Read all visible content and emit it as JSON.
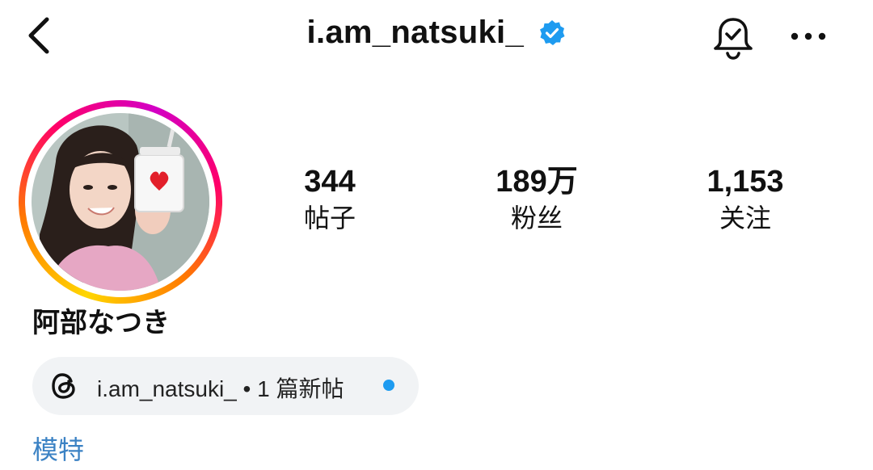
{
  "header": {
    "username": "i.am_natsuki_",
    "verified": true,
    "icons": {
      "back": "chevron-left-icon",
      "verified": "verified-badge-icon",
      "notifications": "bell-check-icon",
      "more": "more-horizontal-icon"
    }
  },
  "profile": {
    "display_name": "阿部なつき",
    "stats": [
      {
        "value": "344",
        "label": "帖子"
      },
      {
        "value": "189万",
        "label": "粉丝"
      },
      {
        "value": "1,153",
        "label": "关注"
      }
    ],
    "threads_badge": {
      "text": "i.am_natsuki_ • 1 篇新帖",
      "icon": "threads-icon",
      "has_new_dot": true
    },
    "category": "模特"
  },
  "colors": {
    "verified": "#1e9bf0",
    "category": "#3b82c4",
    "new_dot": "#1e9bf0",
    "pill_bg": "#f1f3f5"
  }
}
